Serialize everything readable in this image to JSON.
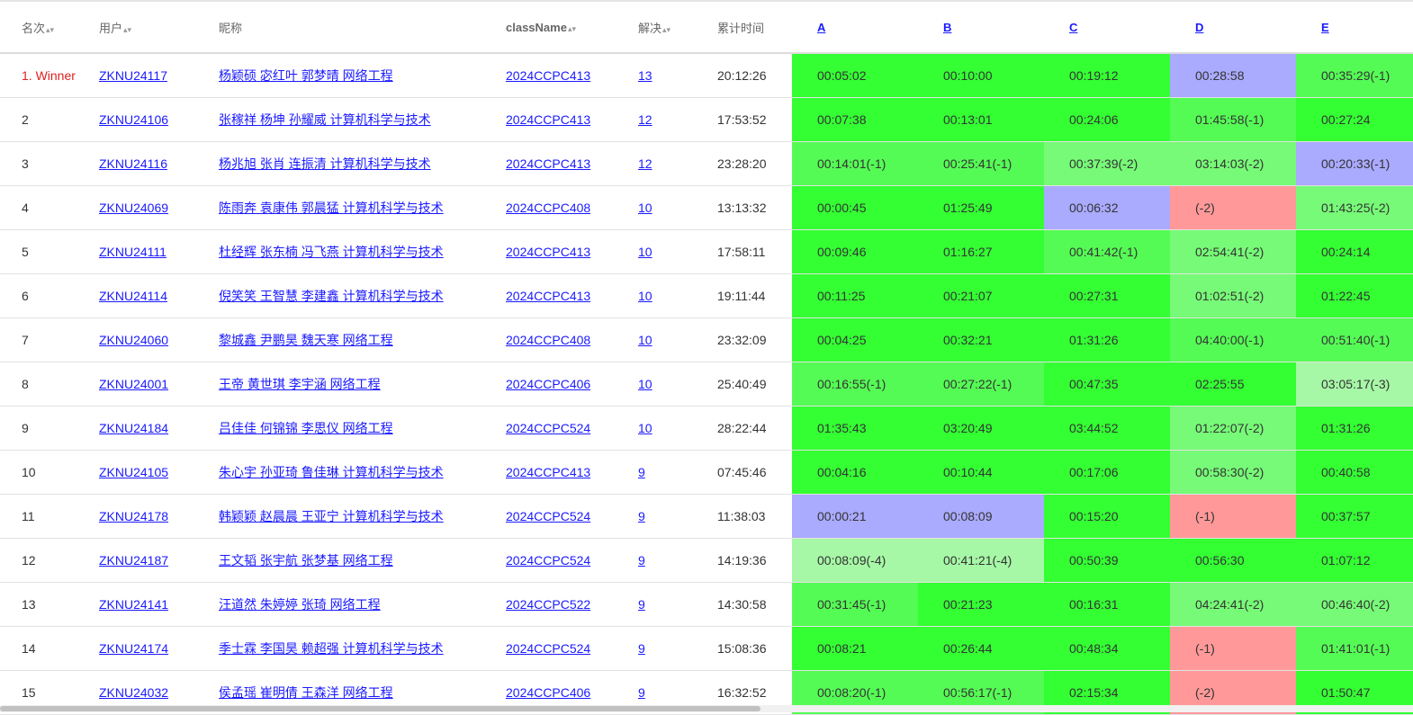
{
  "headers": {
    "rank": "名次",
    "user": "用户",
    "nick": "昵称",
    "class": "className",
    "solved": "解决",
    "time": "累计时间",
    "problems": [
      "A",
      "B",
      "C",
      "D",
      "E"
    ]
  },
  "status_colors": {
    "g1": "#33ff33",
    "g2": "#55fb55",
    "g3": "#77fa77",
    "g4": "#a6f7a6",
    "bl": "#aaaaff",
    "rd": "#ff9999"
  },
  "rows": [
    {
      "rank": "1. Winner",
      "winner": true,
      "user": "ZKNU24117",
      "nick": "杨颖硕 宓红叶 郭梦晴 网络工程",
      "class": "2024CCPC413",
      "solved": "13",
      "time": "20:12:26",
      "cells": [
        {
          "t": "00:05:02",
          "c": "g1"
        },
        {
          "t": "00:10:00",
          "c": "g1"
        },
        {
          "t": "00:19:12",
          "c": "g1"
        },
        {
          "t": "00:28:58",
          "c": "bl"
        },
        {
          "t": "00:35:29(-1)",
          "c": "g2"
        }
      ]
    },
    {
      "rank": "2",
      "user": "ZKNU24106",
      "nick": "张稼祥 杨坤 孙耀威 计算机科学与技术",
      "class": "2024CCPC413",
      "solved": "12",
      "time": "17:53:52",
      "cells": [
        {
          "t": "00:07:38",
          "c": "g1"
        },
        {
          "t": "00:13:01",
          "c": "g1"
        },
        {
          "t": "00:24:06",
          "c": "g1"
        },
        {
          "t": "01:45:58(-1)",
          "c": "g2"
        },
        {
          "t": "00:27:24",
          "c": "g1"
        }
      ]
    },
    {
      "rank": "3",
      "user": "ZKNU24116",
      "nick": "杨兆旭 张肖 连振清 计算机科学与技术",
      "class": "2024CCPC413",
      "solved": "12",
      "time": "23:28:20",
      "cells": [
        {
          "t": "00:14:01(-1)",
          "c": "g2"
        },
        {
          "t": "00:25:41(-1)",
          "c": "g2"
        },
        {
          "t": "00:37:39(-2)",
          "c": "g3"
        },
        {
          "t": "03:14:03(-2)",
          "c": "g3"
        },
        {
          "t": "00:20:33(-1)",
          "c": "bl"
        }
      ]
    },
    {
      "rank": "4",
      "user": "ZKNU24069",
      "nick": "陈雨奔 袁康伟 郭晨猛 计算机科学与技术",
      "class": "2024CCPC408",
      "solved": "10",
      "time": "13:13:32",
      "cells": [
        {
          "t": "00:00:45",
          "c": "g1"
        },
        {
          "t": "01:25:49",
          "c": "g1"
        },
        {
          "t": "00:06:32",
          "c": "bl"
        },
        {
          "t": "(-2)",
          "c": "rd"
        },
        {
          "t": "01:43:25(-2)",
          "c": "g3"
        }
      ]
    },
    {
      "rank": "5",
      "user": "ZKNU24111",
      "nick": "杜经辉 张东楠 冯飞燕 计算机科学与技术",
      "class": "2024CCPC413",
      "solved": "10",
      "time": "17:58:11",
      "cells": [
        {
          "t": "00:09:46",
          "c": "g1"
        },
        {
          "t": "01:16:27",
          "c": "g1"
        },
        {
          "t": "00:41:42(-1)",
          "c": "g2"
        },
        {
          "t": "02:54:41(-2)",
          "c": "g3"
        },
        {
          "t": "00:24:14",
          "c": "g1"
        }
      ]
    },
    {
      "rank": "6",
      "user": "ZKNU24114",
      "nick": "倪笑笑 王智慧 李建鑫 计算机科学与技术",
      "class": "2024CCPC413",
      "solved": "10",
      "time": "19:11:44",
      "cells": [
        {
          "t": "00:11:25",
          "c": "g1"
        },
        {
          "t": "00:21:07",
          "c": "g1"
        },
        {
          "t": "00:27:31",
          "c": "g1"
        },
        {
          "t": "01:02:51(-2)",
          "c": "g3"
        },
        {
          "t": "01:22:45",
          "c": "g1"
        }
      ]
    },
    {
      "rank": "7",
      "user": "ZKNU24060",
      "nick": "黎城鑫 尹鹏昊 魏天寒 网络工程",
      "class": "2024CCPC408",
      "solved": "10",
      "time": "23:32:09",
      "cells": [
        {
          "t": "00:04:25",
          "c": "g1"
        },
        {
          "t": "00:32:21",
          "c": "g1"
        },
        {
          "t": "01:31:26",
          "c": "g1"
        },
        {
          "t": "04:40:00(-1)",
          "c": "g2"
        },
        {
          "t": "00:51:40(-1)",
          "c": "g2"
        }
      ]
    },
    {
      "rank": "8",
      "user": "ZKNU24001",
      "nick": "王帝 黄世琪 李宇涵 网络工程",
      "class": "2024CCPC406",
      "solved": "10",
      "time": "25:40:49",
      "cells": [
        {
          "t": "00:16:55(-1)",
          "c": "g2"
        },
        {
          "t": "00:27:22(-1)",
          "c": "g2"
        },
        {
          "t": "00:47:35",
          "c": "g1"
        },
        {
          "t": "02:25:55",
          "c": "g1"
        },
        {
          "t": "03:05:17(-3)",
          "c": "g4"
        }
      ]
    },
    {
      "rank": "9",
      "user": "ZKNU24184",
      "nick": "吕佳佳 何锦锦 李思仪 网络工程",
      "class": "2024CCPC524",
      "solved": "10",
      "time": "28:22:44",
      "cells": [
        {
          "t": "01:35:43",
          "c": "g1"
        },
        {
          "t": "03:20:49",
          "c": "g1"
        },
        {
          "t": "03:44:52",
          "c": "g1"
        },
        {
          "t": "01:22:07(-2)",
          "c": "g3"
        },
        {
          "t": "01:31:26",
          "c": "g1"
        }
      ]
    },
    {
      "rank": "10",
      "user": "ZKNU24105",
      "nick": "朱心宇 孙亚琦 鲁佳琳 计算机科学与技术",
      "class": "2024CCPC413",
      "solved": "9",
      "time": "07:45:46",
      "cells": [
        {
          "t": "00:04:16",
          "c": "g1"
        },
        {
          "t": "00:10:44",
          "c": "g1"
        },
        {
          "t": "00:17:06",
          "c": "g1"
        },
        {
          "t": "00:58:30(-2)",
          "c": "g3"
        },
        {
          "t": "00:40:58",
          "c": "g1"
        }
      ]
    },
    {
      "rank": "11",
      "user": "ZKNU24178",
      "nick": "韩颖颖 赵晨晨 王亚宁 计算机科学与技术",
      "class": "2024CCPC524",
      "solved": "9",
      "time": "11:38:03",
      "cells": [
        {
          "t": "00:00:21",
          "c": "bl"
        },
        {
          "t": "00:08:09",
          "c": "bl"
        },
        {
          "t": "00:15:20",
          "c": "g1"
        },
        {
          "t": "(-1)",
          "c": "rd"
        },
        {
          "t": "00:37:57",
          "c": "g1"
        }
      ]
    },
    {
      "rank": "12",
      "user": "ZKNU24187",
      "nick": "王文韬 张宇航 张梦基 网络工程",
      "class": "2024CCPC524",
      "solved": "9",
      "time": "14:19:36",
      "cells": [
        {
          "t": "00:08:09(-4)",
          "c": "g4"
        },
        {
          "t": "00:41:21(-4)",
          "c": "g4"
        },
        {
          "t": "00:50:39",
          "c": "g1"
        },
        {
          "t": "00:56:30",
          "c": "g1"
        },
        {
          "t": "01:07:12",
          "c": "g1"
        }
      ]
    },
    {
      "rank": "13",
      "user": "ZKNU24141",
      "nick": "汪道然 朱婷婷 张琦 网络工程",
      "class": "2024CCPC522",
      "solved": "9",
      "time": "14:30:58",
      "cells": [
        {
          "t": "00:31:45(-1)",
          "c": "g2"
        },
        {
          "t": "00:21:23",
          "c": "g1"
        },
        {
          "t": "00:16:31",
          "c": "g1"
        },
        {
          "t": "04:24:41(-2)",
          "c": "g3"
        },
        {
          "t": "00:46:40(-2)",
          "c": "g3"
        }
      ]
    },
    {
      "rank": "14",
      "user": "ZKNU24174",
      "nick": "季士霖 李国昊 赖超强 计算机科学与技术",
      "class": "2024CCPC524",
      "solved": "9",
      "time": "15:08:36",
      "cells": [
        {
          "t": "00:08:21",
          "c": "g1"
        },
        {
          "t": "00:26:44",
          "c": "g1"
        },
        {
          "t": "00:48:34",
          "c": "g1"
        },
        {
          "t": "(-1)",
          "c": "rd"
        },
        {
          "t": "01:41:01(-1)",
          "c": "g2"
        }
      ]
    },
    {
      "rank": "15",
      "user": "ZKNU24032",
      "nick": "侯孟瑶 崔明倩 王森洋 网络工程",
      "class": "2024CCPC406",
      "solved": "9",
      "time": "16:32:52",
      "cells": [
        {
          "t": "00:08:20(-1)",
          "c": "g2"
        },
        {
          "t": "00:56:17(-1)",
          "c": "g2"
        },
        {
          "t": "02:15:34",
          "c": "g1"
        },
        {
          "t": "(-2)",
          "c": "rd"
        },
        {
          "t": "01:50:47",
          "c": "g1"
        }
      ]
    }
  ]
}
